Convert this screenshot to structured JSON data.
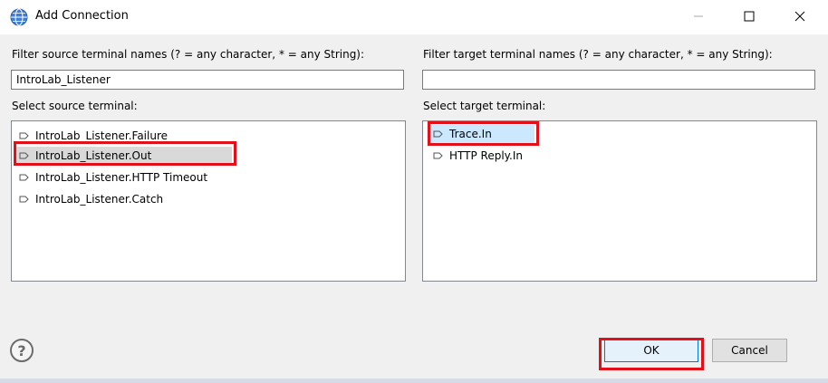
{
  "window": {
    "title": "Add Connection",
    "controls": {
      "minimize": "—",
      "maximize": "☐",
      "close": "✕"
    }
  },
  "source": {
    "filter_label": "Filter source terminal names (? = any character, * = any String):",
    "filter_value": "IntroLab_Listener",
    "select_label": "Select source terminal:",
    "items": [
      "IntroLab_Listener.Failure",
      "IntroLab_Listener.Out",
      "IntroLab_Listener.HTTP Timeout",
      "IntroLab_Listener.Catch"
    ],
    "selected": "IntroLab_Listener.Out"
  },
  "target": {
    "filter_label": "Filter target terminal names (? = any character, * = any String):",
    "filter_value": "",
    "select_label": "Select target terminal:",
    "items": [
      "Trace.In",
      "HTTP Reply.In"
    ],
    "selected": "Trace.In"
  },
  "buttons": {
    "help": "?",
    "ok": "OK",
    "cancel": "Cancel"
  },
  "icons": {
    "app": "globe-icon",
    "terminal": "terminal-connector-icon",
    "help": "help-icon"
  },
  "colors": {
    "highlight": "#e3101a",
    "selection_blue": "#cce8ff",
    "selection_gray": "#d9d9d9",
    "dialog_bg": "#f0f0f0"
  }
}
